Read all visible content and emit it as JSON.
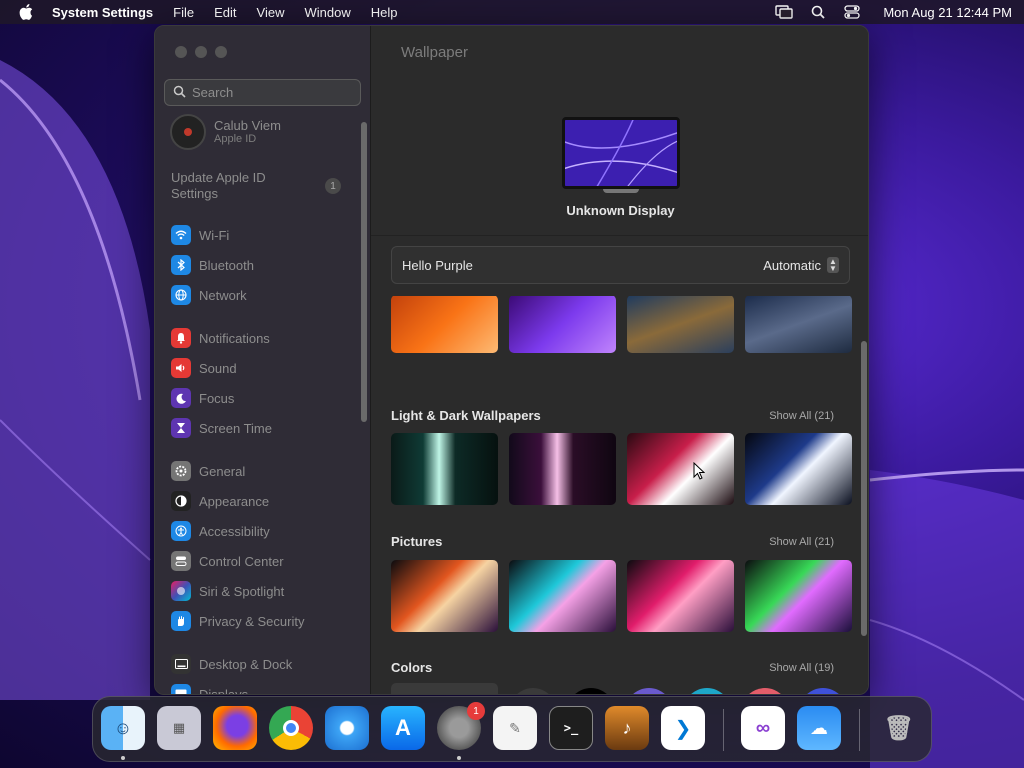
{
  "menubar": {
    "app_name": "System Settings",
    "menus": [
      "File",
      "Edit",
      "View",
      "Window",
      "Help"
    ],
    "clock": "Mon Aug 21  12:44 PM"
  },
  "sidebar": {
    "search_placeholder": "Search",
    "account": {
      "name": "Calub Viem",
      "sub": "Apple ID"
    },
    "update": {
      "label": "Update Apple ID Settings",
      "count": "1"
    },
    "items": [
      {
        "label": "Wi-Fi",
        "icon": "wifi-icon",
        "color": "#1e88e5"
      },
      {
        "label": "Bluetooth",
        "icon": "bluetooth-icon",
        "color": "#1e88e5"
      },
      {
        "label": "Network",
        "icon": "network-icon",
        "color": "#1e88e5"
      },
      {
        "label": "Notifications",
        "icon": "notifications-icon",
        "color": "#e53935"
      },
      {
        "label": "Sound",
        "icon": "sound-icon",
        "color": "#e53935"
      },
      {
        "label": "Focus",
        "icon": "focus-icon",
        "color": "#5e35b1"
      },
      {
        "label": "Screen Time",
        "icon": "screen-time-icon",
        "color": "#5e35b1"
      },
      {
        "label": "General",
        "icon": "general-icon",
        "color": "#757575"
      },
      {
        "label": "Appearance",
        "icon": "appearance-icon",
        "color": "#222222"
      },
      {
        "label": "Accessibility",
        "icon": "accessibility-icon",
        "color": "#1e88e5"
      },
      {
        "label": "Control Center",
        "icon": "control-center-icon",
        "color": "#757575"
      },
      {
        "label": "Siri & Spotlight",
        "icon": "siri-icon",
        "color": "#8e24aa"
      },
      {
        "label": "Privacy & Security",
        "icon": "privacy-icon",
        "color": "#1e88e5"
      },
      {
        "label": "Desktop & Dock",
        "icon": "desktop-dock-icon",
        "color": "#333333"
      },
      {
        "label": "Displays",
        "icon": "displays-icon",
        "color": "#1e88e5"
      }
    ]
  },
  "main": {
    "title": "Wallpaper",
    "display_name": "Unknown Display",
    "current_wallpaper": "Hello Purple",
    "mode": "Automatic",
    "sections": {
      "light_dark": {
        "title": "Light & Dark Wallpapers",
        "show_all": "Show All (21)"
      },
      "pictures": {
        "title": "Pictures",
        "show_all": "Show All (21)"
      },
      "colors": {
        "title": "Colors",
        "show_all": "Show All (19)"
      }
    },
    "color_swatches": [
      "#000000",
      "#6a5acd",
      "#1ea7c9",
      "#e35d6a",
      "#3f51d9"
    ]
  },
  "dock": {
    "apps": [
      {
        "name": "Finder",
        "icon": "finder-icon"
      },
      {
        "name": "Launchpad",
        "icon": "launchpad-icon"
      },
      {
        "name": "Firefox",
        "icon": "firefox-icon"
      },
      {
        "name": "Chrome",
        "icon": "chrome-icon"
      },
      {
        "name": "Safari",
        "icon": "safari-icon"
      },
      {
        "name": "App Store",
        "icon": "app-store-icon"
      },
      {
        "name": "System Settings",
        "icon": "system-settings-icon",
        "badge": "1"
      },
      {
        "name": "TextEdit",
        "icon": "textedit-icon"
      },
      {
        "name": "Terminal",
        "icon": "terminal-icon"
      },
      {
        "name": "GarageBand",
        "icon": "garageband-icon"
      },
      {
        "name": "VS Code",
        "icon": "vscode-icon"
      },
      {
        "name": "Visual Studio",
        "icon": "visual-studio-icon"
      },
      {
        "name": "Weather",
        "icon": "weather-icon"
      },
      {
        "name": "Trash",
        "icon": "trash-icon"
      }
    ]
  }
}
